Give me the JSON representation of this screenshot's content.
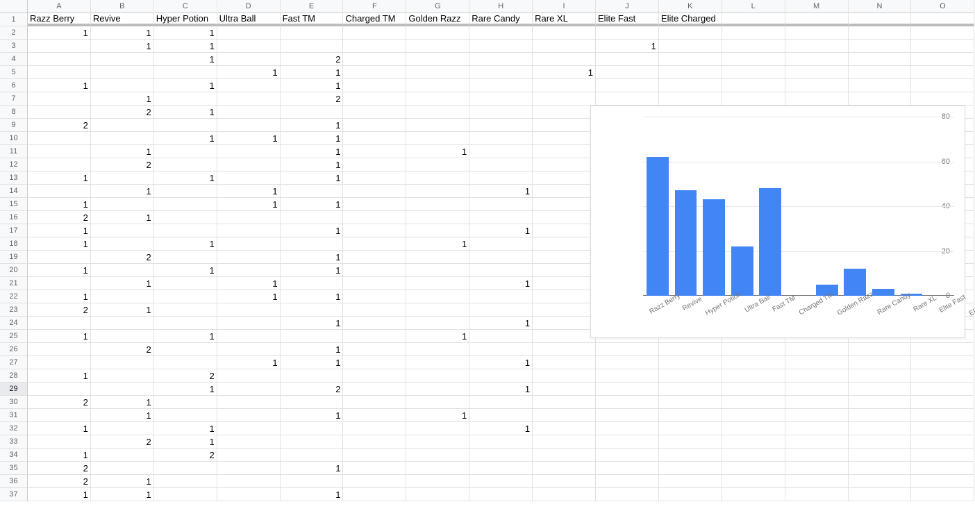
{
  "columns": [
    "A",
    "B",
    "C",
    "D",
    "E",
    "F",
    "G",
    "H",
    "I",
    "J",
    "K",
    "L",
    "M",
    "N",
    "O"
  ],
  "headers": [
    "Razz Berry",
    "Revive",
    "Hyper Potion",
    "Ultra Ball",
    "Fast TM",
    "Charged TM",
    "Golden Razz",
    "Rare Candy",
    "Rare XL",
    "Elite Fast",
    "Elite Charged",
    "",
    "",
    "",
    ""
  ],
  "selected_row": 29,
  "rows": [
    {
      "r": 2,
      "A": 1,
      "B": 1,
      "C": 1
    },
    {
      "r": 3,
      "B": 1,
      "C": 1,
      "J": 1
    },
    {
      "r": 4,
      "C": 1,
      "E": 2
    },
    {
      "r": 5,
      "D": 1,
      "E": 1,
      "I": 1
    },
    {
      "r": 6,
      "A": 1,
      "C": 1,
      "E": 1
    },
    {
      "r": 7,
      "B": 1,
      "E": 2
    },
    {
      "r": 8,
      "B": 2,
      "C": 1
    },
    {
      "r": 9,
      "A": 2,
      "E": 1
    },
    {
      "r": 10,
      "C": 1,
      "D": 1,
      "E": 1
    },
    {
      "r": 11,
      "B": 1,
      "E": 1,
      "G": 1
    },
    {
      "r": 12,
      "B": 2,
      "E": 1
    },
    {
      "r": 13,
      "A": 1,
      "C": 1,
      "E": 1
    },
    {
      "r": 14,
      "B": 1,
      "D": 1,
      "H": 1
    },
    {
      "r": 15,
      "A": 1,
      "D": 1,
      "E": 1
    },
    {
      "r": 16,
      "A": 2,
      "B": 1
    },
    {
      "r": 17,
      "A": 1,
      "E": 1,
      "H": 1
    },
    {
      "r": 18,
      "A": 1,
      "C": 1,
      "G": 1
    },
    {
      "r": 19,
      "B": 2,
      "E": 1
    },
    {
      "r": 20,
      "A": 1,
      "C": 1,
      "E": 1
    },
    {
      "r": 21,
      "B": 1,
      "D": 1,
      "H": 1
    },
    {
      "r": 22,
      "A": 1,
      "D": 1,
      "E": 1
    },
    {
      "r": 23,
      "A": 2,
      "B": 1
    },
    {
      "r": 24,
      "E": 1,
      "H": 1
    },
    {
      "r": 25,
      "A": 1,
      "C": 1,
      "G": 1
    },
    {
      "r": 26,
      "B": 2,
      "E": 1
    },
    {
      "r": 27,
      "D": 1,
      "E": 1,
      "H": 1
    },
    {
      "r": 28,
      "A": 1,
      "C": 2
    },
    {
      "r": 29,
      "C": 1,
      "E": 2,
      "H": 1
    },
    {
      "r": 30,
      "A": 2,
      "B": 1
    },
    {
      "r": 31,
      "B": 1,
      "E": 1,
      "G": 1
    },
    {
      "r": 32,
      "A": 1,
      "C": 1,
      "H": 1
    },
    {
      "r": 33,
      "B": 2,
      "C": 1
    },
    {
      "r": 34,
      "A": 1,
      "C": 2
    },
    {
      "r": 35,
      "A": 2,
      "E": 1
    },
    {
      "r": 36,
      "A": 2,
      "B": 1
    },
    {
      "r": 37,
      "A": 1,
      "B": 1,
      "E": 1
    }
  ],
  "last_row": 37,
  "chart_data": {
    "type": "bar",
    "categories": [
      "Razz Berry",
      "Revive",
      "Hyper Potion",
      "Ultra Ball",
      "Fast TM",
      "Charged TM",
      "Golden Razz",
      "Rare Candy",
      "Rare XL",
      "Elite Fast",
      "Elite Charged"
    ],
    "values": [
      62,
      47,
      43,
      22,
      48,
      0,
      5,
      12,
      3,
      1,
      0
    ],
    "ylim": [
      0,
      80
    ],
    "yticks": [
      0,
      20,
      40,
      60,
      80
    ]
  }
}
